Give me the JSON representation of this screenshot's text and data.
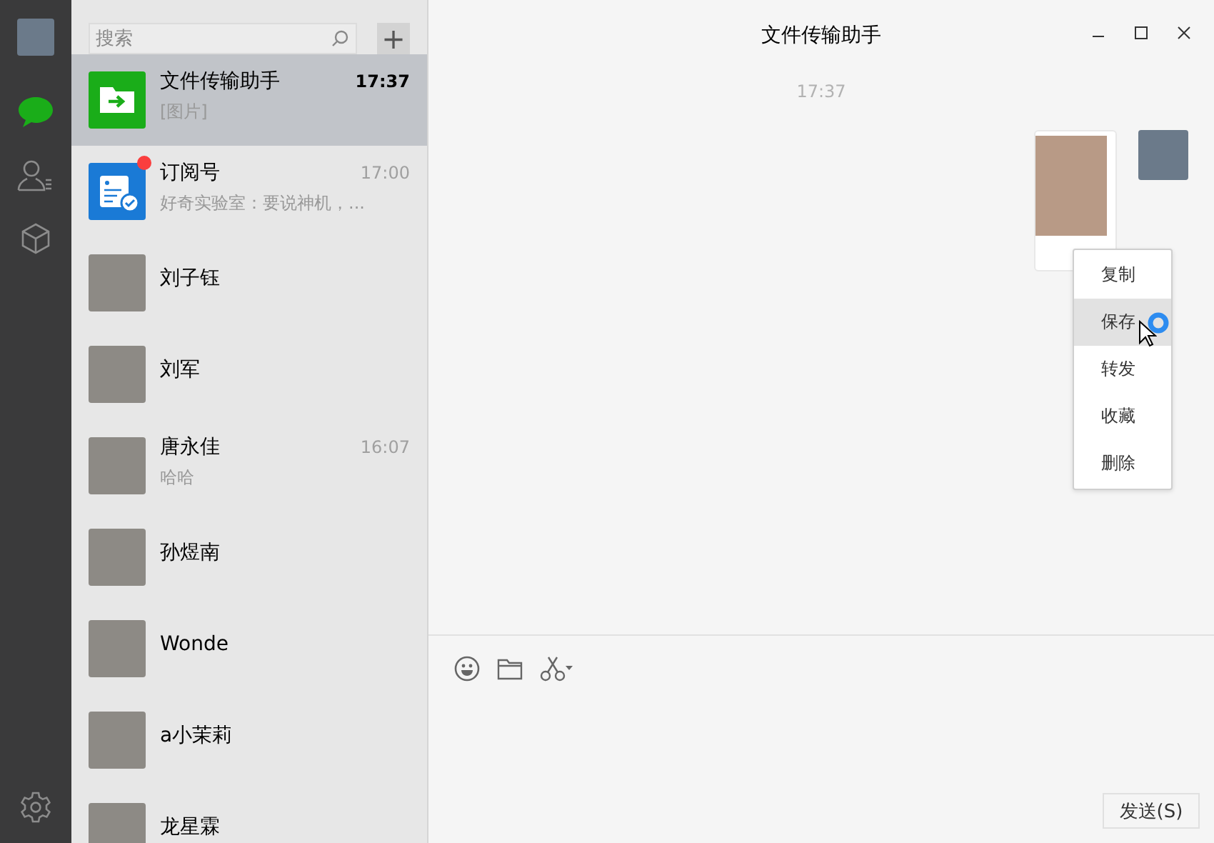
{
  "rail": {
    "nav": [
      {
        "kind": "chats",
        "selected": true
      },
      {
        "kind": "contacts",
        "selected": false
      },
      {
        "kind": "favorites",
        "selected": false
      }
    ]
  },
  "search": {
    "placeholder": "搜索"
  },
  "add_button": {
    "label": "+"
  },
  "chats": [
    {
      "name": "文件传输助手",
      "preview": "[图片]",
      "time": "17:37",
      "kind": "file",
      "unread": false,
      "selected": true
    },
    {
      "name": "订阅号",
      "preview": "好奇实验室：要说神机，...",
      "time": "17:00",
      "kind": "subscription",
      "unread": true,
      "selected": false
    },
    {
      "name": "刘子钰",
      "kind": "photo",
      "unread": false,
      "selected": false
    },
    {
      "name": "刘军",
      "kind": "photo",
      "unread": false,
      "selected": false
    },
    {
      "name": "唐永佳",
      "preview": "哈哈",
      "time": "16:07",
      "kind": "photo",
      "unread": false,
      "selected": false
    },
    {
      "name": "孙煜南",
      "kind": "photo",
      "unread": false,
      "selected": false
    },
    {
      "name": "Wonde",
      "kind": "photo",
      "unread": false,
      "selected": false
    },
    {
      "name": "a小茉莉",
      "kind": "photo",
      "unread": false,
      "selected": false
    },
    {
      "name": "龙星霖",
      "kind": "photo",
      "unread": false,
      "selected": false
    }
  ],
  "conversation": {
    "title": "文件传输助手",
    "timestamp": "17:37"
  },
  "context_menu": [
    {
      "label": "复制",
      "selected": false
    },
    {
      "label": "保存",
      "selected": true
    },
    {
      "label": "转发",
      "selected": false
    },
    {
      "label": "收藏",
      "selected": false
    },
    {
      "label": "删除",
      "selected": false
    }
  ],
  "send_button": {
    "label": "发送(S)"
  }
}
